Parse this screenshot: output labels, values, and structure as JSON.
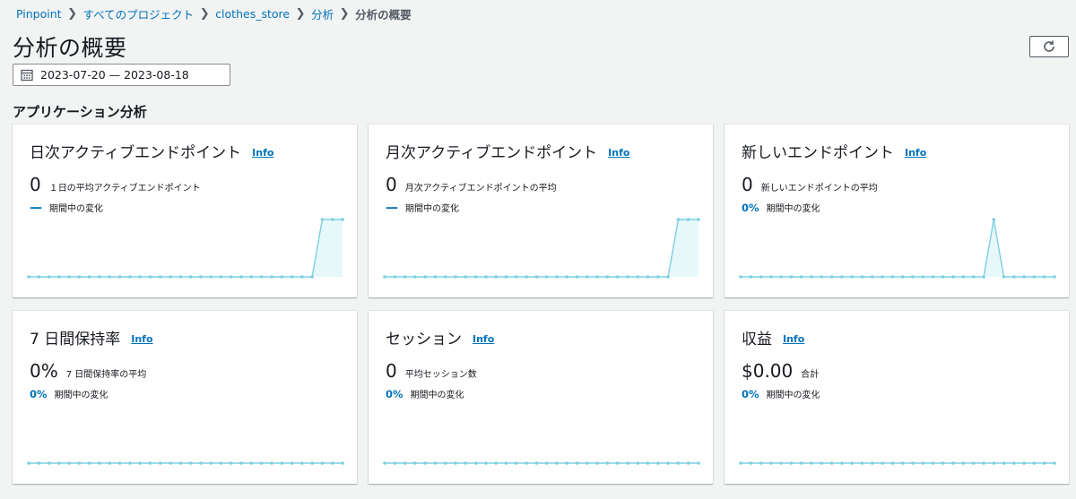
{
  "breadcrumb": {
    "items": [
      "Pinpoint",
      "すべてのプロジェクト",
      "clothes_store",
      "分析"
    ],
    "current": "分析の概要"
  },
  "page": {
    "title": "分析の概要",
    "date_range": "2023-07-20 — 2023-08-18"
  },
  "section": {
    "title": "アプリケーション分析"
  },
  "info_label": "Info",
  "colors": {
    "accent": "#0073bb",
    "spark_line": "#7dcfe0",
    "spark_fill": "#e7f8fb"
  },
  "icons": {
    "refresh": "refresh-icon",
    "calendar": "calendar-icon"
  },
  "cards": [
    {
      "title": "日次アクティブエンドポイント",
      "value": "0",
      "desc": "１日の平均アクティブエンドポイント",
      "change": "—",
      "change_label": "期間中の変化",
      "series": [
        0,
        0,
        0,
        0,
        0,
        0,
        0,
        0,
        0,
        0,
        0,
        0,
        0,
        0,
        0,
        0,
        0,
        0,
        0,
        0,
        0,
        0,
        0,
        0,
        0,
        0,
        0,
        0,
        0,
        1,
        1,
        1
      ]
    },
    {
      "title": "月次アクティブエンドポイント",
      "value": "0",
      "desc": "月次アクティブエンドポイントの平均",
      "change": "—",
      "change_label": "期間中の変化",
      "series": [
        0,
        0,
        0,
        0,
        0,
        0,
        0,
        0,
        0,
        0,
        0,
        0,
        0,
        0,
        0,
        0,
        0,
        0,
        0,
        0,
        0,
        0,
        0,
        0,
        0,
        0,
        0,
        0,
        0,
        1,
        1,
        1
      ]
    },
    {
      "title": "新しいエンドポイント",
      "value": "0",
      "desc": "新しいエンドポイントの平均",
      "change": "0%",
      "change_label": "期間中の変化",
      "series": [
        0,
        0,
        0,
        0,
        0,
        0,
        0,
        0,
        0,
        0,
        0,
        0,
        0,
        0,
        0,
        0,
        0,
        0,
        0,
        0,
        0,
        0,
        0,
        0,
        0,
        1,
        0,
        0,
        0,
        0,
        0,
        0
      ]
    },
    {
      "title": "7 日間保持率",
      "value": "0%",
      "desc": "7 日間保持率の平均",
      "change": "0%",
      "change_label": "期間中の変化",
      "series": [
        0,
        0,
        0,
        0,
        0,
        0,
        0,
        0,
        0,
        0,
        0,
        0,
        0,
        0,
        0,
        0,
        0,
        0,
        0,
        0,
        0,
        0,
        0,
        0,
        0,
        0,
        0,
        0,
        0,
        0,
        0,
        0
      ]
    },
    {
      "title": "セッション",
      "value": "0",
      "desc": "平均セッション数",
      "change": "0%",
      "change_label": "期間中の変化",
      "series": [
        0,
        0,
        0,
        0,
        0,
        0,
        0,
        0,
        0,
        0,
        0,
        0,
        0,
        0,
        0,
        0,
        0,
        0,
        0,
        0,
        0,
        0,
        0,
        0,
        0,
        0,
        0,
        0,
        0,
        0,
        0,
        0
      ]
    },
    {
      "title": "収益",
      "value": "$0.00",
      "desc": "合計",
      "change": "0%",
      "change_label": "期間中の変化",
      "series": [
        0,
        0,
        0,
        0,
        0,
        0,
        0,
        0,
        0,
        0,
        0,
        0,
        0,
        0,
        0,
        0,
        0,
        0,
        0,
        0,
        0,
        0,
        0,
        0,
        0,
        0,
        0,
        0,
        0,
        0,
        0,
        0
      ]
    }
  ]
}
